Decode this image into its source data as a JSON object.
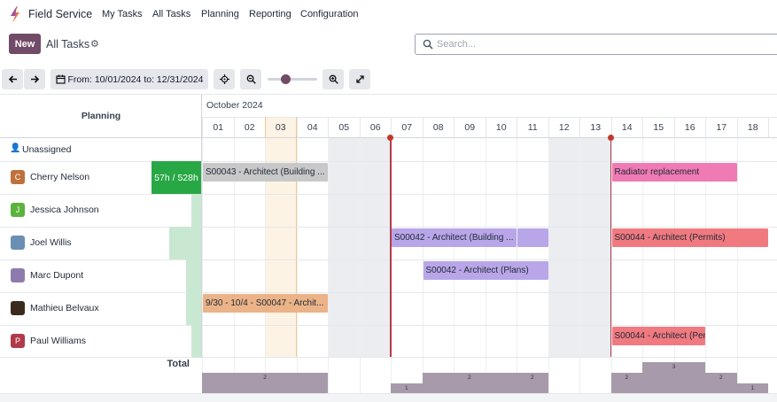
{
  "nav": {
    "app_name": "Field Service",
    "menus": [
      "My Tasks",
      "All Tasks",
      "Planning",
      "Reporting",
      "Configuration"
    ]
  },
  "control": {
    "new_label": "New",
    "breadcrumb": "All Tasks",
    "search_placeholder": "Search..."
  },
  "toolbar": {
    "range_label": "From: 10/01/2024 to: 12/31/2024",
    "zoom_level": 0.3
  },
  "gantt": {
    "header_title": "Planning",
    "month": "October 2024",
    "days": [
      "01",
      "02",
      "03",
      "04",
      "05",
      "06",
      "07",
      "08",
      "09",
      "10",
      "11",
      "12",
      "13",
      "14",
      "15",
      "16",
      "17",
      "18"
    ],
    "weekend_days": [
      "05",
      "06",
      "12",
      "13"
    ],
    "today": "03",
    "unassigned_label": "Unassigned",
    "rows": [
      {
        "name": "Cherry Nelson",
        "initial": "C",
        "avatar_color": "#c0713b",
        "workload_label": "57h / 528h",
        "workload": 1.0
      },
      {
        "name": "Jessica Johnson",
        "initial": "J",
        "avatar_color": "#5bb33b",
        "workload_label": "",
        "workload": 0.2
      },
      {
        "name": "Joel Willis",
        "initial": "",
        "avatar_color": "#6b8fb3",
        "workload_label": "",
        "workload": 0.65
      },
      {
        "name": "Marc Dupont",
        "initial": "",
        "avatar_color": "#8d7bb0",
        "workload_label": "",
        "workload": 0.3
      },
      {
        "name": "Mathieu Belvaux",
        "initial": "",
        "avatar_color": "#3d2a1f",
        "workload_label": "",
        "workload": 0.3
      },
      {
        "name": "Paul Williams",
        "initial": "P",
        "avatar_color": "#b03a4a",
        "workload_label": "",
        "workload": 0.2
      }
    ],
    "tasks": [
      {
        "label": "S00043 - Architect (Building ...",
        "row": 0,
        "start": "01",
        "end": "04",
        "color": "#c8c8c8"
      },
      {
        "label": "Radiator replacement",
        "row": 0,
        "start": "14",
        "end": "17",
        "color": "#f07ab4"
      },
      {
        "label": "S00042 - Architect (Building ...",
        "row": 2,
        "start": "07",
        "end": "10",
        "color": "#b9a6e8"
      },
      {
        "label": "",
        "row": 2,
        "start": "11",
        "end": "11",
        "color": "#b9a6e8"
      },
      {
        "label": "S00044 - Architect (Permits)",
        "row": 2,
        "start": "14",
        "end": "18",
        "color": "#f07a80"
      },
      {
        "label": "S00042 - Architect (Plans)",
        "row": 3,
        "start": "08",
        "end": "11",
        "color": "#b9a6e8"
      },
      {
        "label": "9/30 - 10/4 - S00047 - Archit...",
        "row": 4,
        "start": "01",
        "end": "04",
        "color": "#ebb387"
      },
      {
        "label": "S00044 - Architect (Permits)",
        "row": 5,
        "start": "14",
        "end": "16",
        "color": "#f07a80"
      }
    ],
    "milestone_days": [
      "07",
      "14"
    ],
    "total_label": "Total",
    "totals": [
      {
        "start": "01",
        "end": "04",
        "count": "2",
        "level": 0.67
      },
      {
        "start": "07",
        "end": "07",
        "count": "1",
        "level": 0.33
      },
      {
        "start": "08",
        "end": "10",
        "count": "2",
        "level": 0.67
      },
      {
        "start": "11",
        "end": "11",
        "count": "2",
        "level": 0.67
      },
      {
        "start": "14",
        "end": "14",
        "count": "2",
        "level": 0.67
      },
      {
        "start": "15",
        "end": "16",
        "count": "3",
        "level": 1.0
      },
      {
        "start": "17",
        "end": "17",
        "count": "2",
        "level": 0.67
      },
      {
        "start": "18",
        "end": "18",
        "count": "1",
        "level": 0.33
      }
    ]
  }
}
